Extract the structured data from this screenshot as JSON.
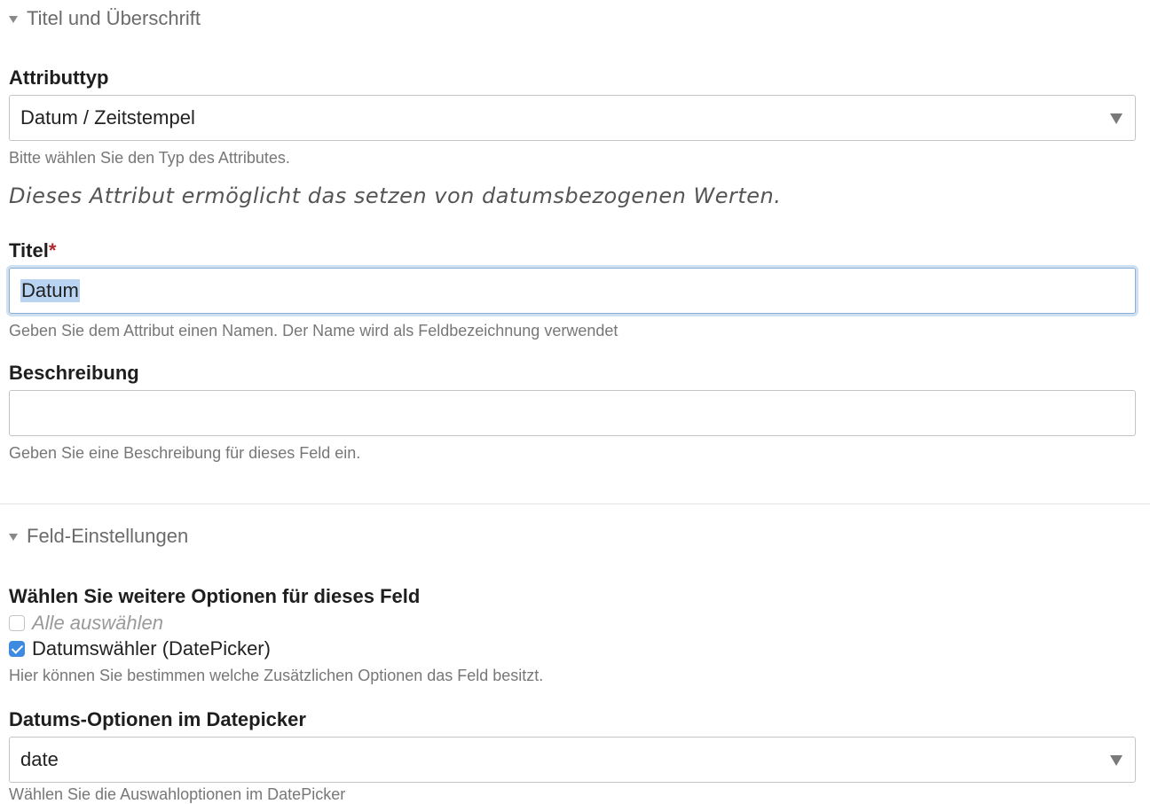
{
  "sections": {
    "title_heading": "Titel und Überschrift",
    "field_settings": "Feld-Einstellungen"
  },
  "attribute_type": {
    "label": "Attributtyp",
    "value": "Datum / Zeitstempel",
    "help": "Bitte wählen Sie den Typ des Attributes.",
    "description": "Dieses Attribut ermöglicht das setzen von datumsbezogenen Werten."
  },
  "title_field": {
    "label": "Titel",
    "required_mark": "*",
    "value": "Datum",
    "help": "Geben Sie dem Attribut einen Namen. Der Name wird als Feldbezeichnung verwendet"
  },
  "description_field": {
    "label": "Beschreibung",
    "value": "",
    "help": "Geben Sie eine Beschreibung für dieses Feld ein."
  },
  "options": {
    "label": "Wählen Sie weitere Optionen für dieses Feld",
    "select_all": "Alle auswählen",
    "datepicker": "Datumswähler (DatePicker)",
    "datepicker_checked": true,
    "help": "Hier können Sie bestimmen welche Zusätzlichen Optionen das Feld besitzt."
  },
  "date_options": {
    "label": "Datums-Optionen im Datepicker",
    "value": "date",
    "help": "Wählen Sie die Auswahloptionen im DatePicker"
  },
  "colors": {
    "accent": "#3d8ae0",
    "focus_ring": "#cfe0f2",
    "required": "#b02a2a"
  }
}
